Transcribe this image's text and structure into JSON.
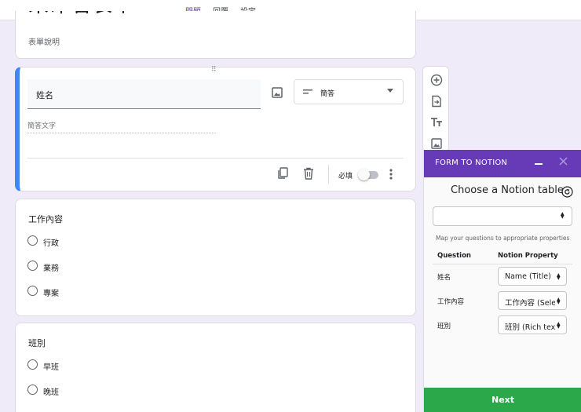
{
  "tabs": [
    {
      "label": "問題",
      "active": true
    },
    {
      "label": "回覆",
      "active": false
    },
    {
      "label": "設定",
      "active": false
    }
  ],
  "form_header": {
    "title": "未命名表單",
    "description_placeholder": "表單說明"
  },
  "active_question": {
    "title": "姓名",
    "type_label": "簡答",
    "answer_placeholder": "簡答文字",
    "required_label": "必填",
    "required_on": false
  },
  "questions": [
    {
      "title": "工作內容",
      "options": [
        "行政",
        "業務",
        "專案"
      ]
    },
    {
      "title": "班別",
      "options": [
        "早班",
        "晚班"
      ]
    }
  ],
  "side_toolbar": {
    "icons": [
      "add-question-icon",
      "import-questions-icon",
      "add-title-icon",
      "add-image-icon"
    ]
  },
  "notion_panel": {
    "header_title": "FORM TO NOTION",
    "choose_title": "Choose a Notion table",
    "table_select_value": "",
    "map_hint": "Map your questions to appropriate properties",
    "col_question": "Question",
    "col_property": "Notion Property",
    "mappings": [
      {
        "question": "姓名",
        "property": "Name (Title)"
      },
      {
        "question": "工作內容",
        "property": "工作內容 (Select)"
      },
      {
        "question": "班別",
        "property": "班別 (Rich text)"
      }
    ],
    "next_label": "Next"
  },
  "colors": {
    "accent": "#673ab7",
    "page_bg": "#f0ebf8",
    "active_border": "#4285f4",
    "next_button": "#2aa84a"
  }
}
